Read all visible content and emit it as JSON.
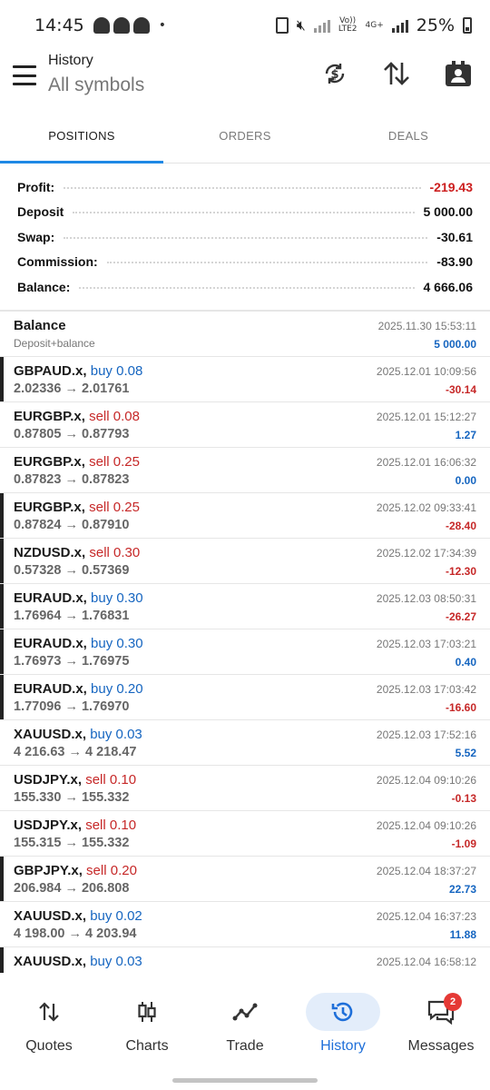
{
  "status_bar": {
    "time": "14:45",
    "battery": "25%",
    "network_label_1": "Vo))",
    "network_label_2": "LTE2",
    "network_label_3": "4G+"
  },
  "header": {
    "title": "History",
    "subtitle": "All symbols"
  },
  "tabs": [
    {
      "label": "POSITIONS",
      "active": true
    },
    {
      "label": "ORDERS",
      "active": false
    },
    {
      "label": "DEALS",
      "active": false
    }
  ],
  "summary": {
    "profit_label": "Profit:",
    "profit": "-219.43",
    "deposit_label": "Deposit",
    "deposit": "5 000.00",
    "swap_label": "Swap:",
    "swap": "-30.61",
    "commission_label": "Commission:",
    "commission": "-83.90",
    "balance_label": "Balance:",
    "balance": "4 666.06"
  },
  "balance_row": {
    "title": "Balance",
    "subtitle": "Deposit+balance",
    "time": "2025.11.30 15:53:11",
    "amount": "5 000.00"
  },
  "positions": [
    {
      "symbol": "GBPAUD.x,",
      "side": "buy 0.08",
      "sideType": "buy",
      "prices": "2.02336 → 2.01761",
      "time": "2025.12.01 10:09:56",
      "profit": "-30.14",
      "marked": true
    },
    {
      "symbol": "EURGBP.x,",
      "side": "sell 0.08",
      "sideType": "sell",
      "prices": "0.87805 → 0.87793",
      "time": "2025.12.01 15:12:27",
      "profit": "1.27",
      "marked": false
    },
    {
      "symbol": "EURGBP.x,",
      "side": "sell 0.25",
      "sideType": "sell",
      "prices": "0.87823 → 0.87823",
      "time": "2025.12.01 16:06:32",
      "profit": "0.00",
      "marked": false
    },
    {
      "symbol": "EURGBP.x,",
      "side": "sell 0.25",
      "sideType": "sell",
      "prices": "0.87824 → 0.87910",
      "time": "2025.12.02 09:33:41",
      "profit": "-28.40",
      "marked": true
    },
    {
      "symbol": "NZDUSD.x,",
      "side": "sell 0.30",
      "sideType": "sell",
      "prices": "0.57328 → 0.57369",
      "time": "2025.12.02 17:34:39",
      "profit": "-12.30",
      "marked": true
    },
    {
      "symbol": "EURAUD.x,",
      "side": "buy 0.30",
      "sideType": "buy",
      "prices": "1.76964 → 1.76831",
      "time": "2025.12.03 08:50:31",
      "profit": "-26.27",
      "marked": true
    },
    {
      "symbol": "EURAUD.x,",
      "side": "buy 0.30",
      "sideType": "buy",
      "prices": "1.76973 → 1.76975",
      "time": "2025.12.03 17:03:21",
      "profit": "0.40",
      "marked": true
    },
    {
      "symbol": "EURAUD.x,",
      "side": "buy 0.20",
      "sideType": "buy",
      "prices": "1.77096 → 1.76970",
      "time": "2025.12.03 17:03:42",
      "profit": "-16.60",
      "marked": true
    },
    {
      "symbol": "XAUUSD.x,",
      "side": "buy 0.03",
      "sideType": "buy",
      "prices": "4 216.63 → 4 218.47",
      "time": "2025.12.03 17:52:16",
      "profit": "5.52",
      "marked": false
    },
    {
      "symbol": "USDJPY.x,",
      "side": "sell 0.10",
      "sideType": "sell",
      "prices": "155.330 → 155.332",
      "time": "2025.12.04 09:10:26",
      "profit": "-0.13",
      "marked": false
    },
    {
      "symbol": "USDJPY.x,",
      "side": "sell 0.10",
      "sideType": "sell",
      "prices": "155.315 → 155.332",
      "time": "2025.12.04 09:10:26",
      "profit": "-1.09",
      "marked": false
    },
    {
      "symbol": "GBPJPY.x,",
      "side": "sell 0.20",
      "sideType": "sell",
      "prices": "206.984 → 206.808",
      "time": "2025.12.04 18:37:27",
      "profit": "22.73",
      "marked": true
    },
    {
      "symbol": "XAUUSD.x,",
      "side": "buy 0.02",
      "sideType": "buy",
      "prices": "4 198.00 → 4 203.94",
      "time": "2025.12.04 16:37:23",
      "profit": "11.88",
      "marked": false
    },
    {
      "symbol": "XAUUSD.x,",
      "side": "buy 0.03",
      "sideType": "buy",
      "prices": "",
      "time": "2025.12.04 16:58:12",
      "profit": "",
      "marked": true
    }
  ],
  "bottom_nav": [
    {
      "label": "Quotes",
      "icon": "quotes-icon",
      "active": false
    },
    {
      "label": "Charts",
      "icon": "charts-icon",
      "active": false
    },
    {
      "label": "Trade",
      "icon": "trade-icon",
      "active": false
    },
    {
      "label": "History",
      "icon": "history-icon",
      "active": true
    },
    {
      "label": "Messages",
      "icon": "messages-icon",
      "active": false,
      "badge": "2"
    }
  ],
  "colors": {
    "accent": "#1e6fd9",
    "buy": "#1565c0",
    "sell": "#c62828",
    "profit_negative": "#cc1e1e"
  }
}
